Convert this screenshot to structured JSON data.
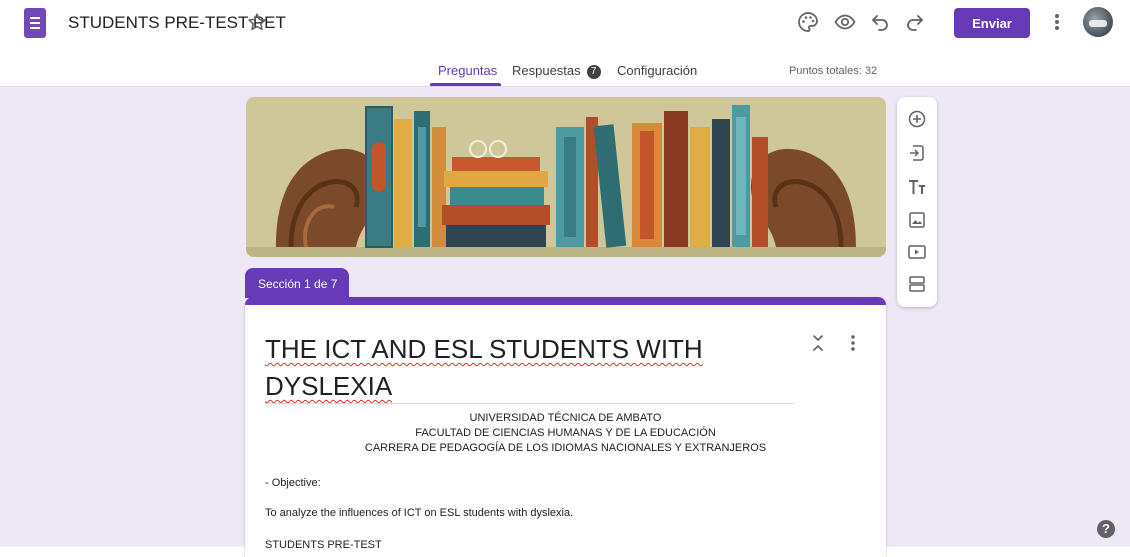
{
  "header": {
    "title": "STUDENTS PRE-TEST PET",
    "send_label": "Enviar",
    "icons": [
      "forms-logo-icon",
      "star-icon",
      "palette-icon",
      "preview-eye-icon",
      "undo-icon",
      "redo-icon",
      "more-vert-icon",
      "avatar"
    ]
  },
  "tabs": [
    {
      "label": "Preguntas",
      "active": true
    },
    {
      "label": "Respuestas",
      "badge": "7"
    },
    {
      "label": "Configuración"
    }
  ],
  "points_total": "Puntos totales: 32",
  "section": {
    "label": "Sección 1 de 7",
    "title": "THE ICT AND ESL STUDENTS WITH DYSLEXIA",
    "header_lines": [
      "UNIVERSIDAD TÉCNICA DE AMBATO",
      "FACULTAD DE CIENCIAS HUMANAS Y DE LA EDUCACIÓN",
      "CARRERA DE PEDAGOGÍA DE LOS IDIOMAS NACIONALES Y EXTRANJEROS"
    ],
    "objective_label": "- Objective:",
    "objective_text": "To analyze the influences of ICT on ESL students with dyslexia.",
    "footer_text": "STUDENTS PRE-TEST"
  },
  "side_tools": [
    "add-question-icon",
    "import-questions-icon",
    "add-title-icon",
    "add-image-icon",
    "add-video-icon",
    "add-section-icon"
  ],
  "help_label": "?",
  "colors": {
    "accent": "#673ab7",
    "canvas": "#ede7f6",
    "banner_bg": "#cfc79a"
  }
}
